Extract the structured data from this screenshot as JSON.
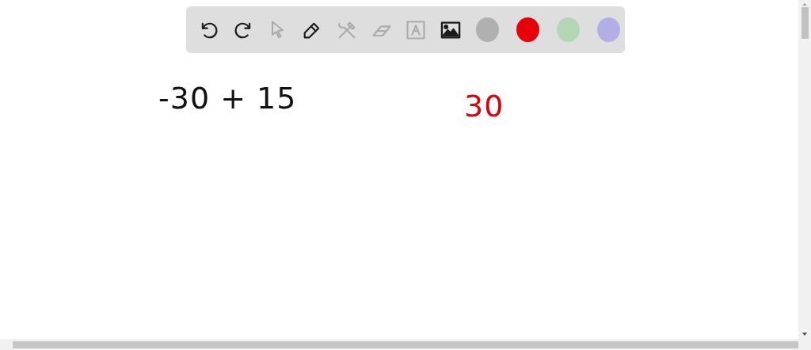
{
  "toolbar": {
    "tools": [
      {
        "kind": "undo",
        "disabled": false
      },
      {
        "kind": "redo",
        "disabled": false
      },
      {
        "kind": "select",
        "disabled": true
      },
      {
        "kind": "pen",
        "disabled": false
      },
      {
        "kind": "tools",
        "disabled": true
      },
      {
        "kind": "eraser",
        "disabled": true
      },
      {
        "kind": "text",
        "disabled": true
      },
      {
        "kind": "image",
        "disabled": false
      }
    ],
    "colors": [
      {
        "color": "#b0b0b0"
      },
      {
        "color": "#e8000b"
      },
      {
        "color": "#b5d6b5"
      },
      {
        "color": "#b3afe6"
      }
    ]
  },
  "canvas": {
    "ink": [
      {
        "text": "-30 + 15",
        "color": "#111111"
      },
      {
        "text": "30",
        "color": "#e0000a"
      }
    ]
  }
}
